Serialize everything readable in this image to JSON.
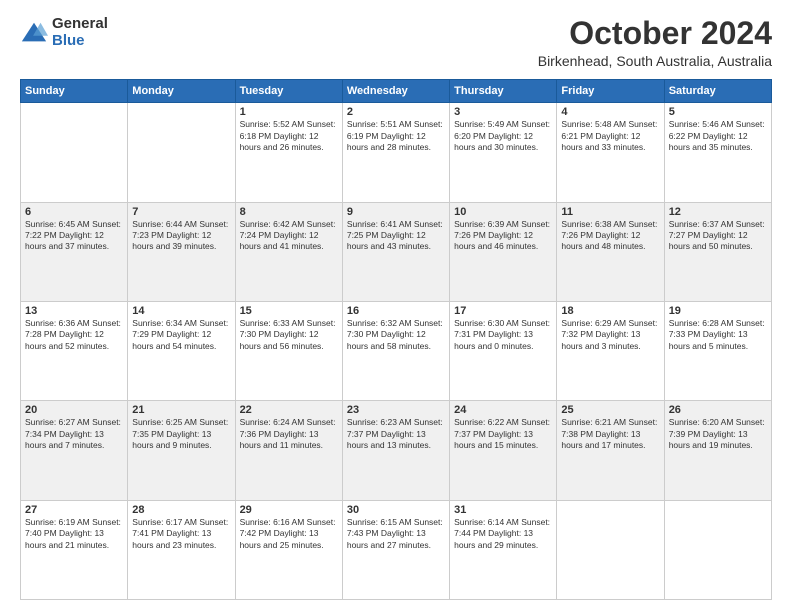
{
  "logo": {
    "general": "General",
    "blue": "Blue"
  },
  "title": "October 2024",
  "subtitle": "Birkenhead, South Australia, Australia",
  "days_of_week": [
    "Sunday",
    "Monday",
    "Tuesday",
    "Wednesday",
    "Thursday",
    "Friday",
    "Saturday"
  ],
  "weeks": [
    [
      {
        "day": "",
        "info": ""
      },
      {
        "day": "",
        "info": ""
      },
      {
        "day": "1",
        "info": "Sunrise: 5:52 AM\nSunset: 6:18 PM\nDaylight: 12 hours\nand 26 minutes."
      },
      {
        "day": "2",
        "info": "Sunrise: 5:51 AM\nSunset: 6:19 PM\nDaylight: 12 hours\nand 28 minutes."
      },
      {
        "day": "3",
        "info": "Sunrise: 5:49 AM\nSunset: 6:20 PM\nDaylight: 12 hours\nand 30 minutes."
      },
      {
        "day": "4",
        "info": "Sunrise: 5:48 AM\nSunset: 6:21 PM\nDaylight: 12 hours\nand 33 minutes."
      },
      {
        "day": "5",
        "info": "Sunrise: 5:46 AM\nSunset: 6:22 PM\nDaylight: 12 hours\nand 35 minutes."
      }
    ],
    [
      {
        "day": "6",
        "info": "Sunrise: 6:45 AM\nSunset: 7:22 PM\nDaylight: 12 hours\nand 37 minutes."
      },
      {
        "day": "7",
        "info": "Sunrise: 6:44 AM\nSunset: 7:23 PM\nDaylight: 12 hours\nand 39 minutes."
      },
      {
        "day": "8",
        "info": "Sunrise: 6:42 AM\nSunset: 7:24 PM\nDaylight: 12 hours\nand 41 minutes."
      },
      {
        "day": "9",
        "info": "Sunrise: 6:41 AM\nSunset: 7:25 PM\nDaylight: 12 hours\nand 43 minutes."
      },
      {
        "day": "10",
        "info": "Sunrise: 6:39 AM\nSunset: 7:26 PM\nDaylight: 12 hours\nand 46 minutes."
      },
      {
        "day": "11",
        "info": "Sunrise: 6:38 AM\nSunset: 7:26 PM\nDaylight: 12 hours\nand 48 minutes."
      },
      {
        "day": "12",
        "info": "Sunrise: 6:37 AM\nSunset: 7:27 PM\nDaylight: 12 hours\nand 50 minutes."
      }
    ],
    [
      {
        "day": "13",
        "info": "Sunrise: 6:36 AM\nSunset: 7:28 PM\nDaylight: 12 hours\nand 52 minutes."
      },
      {
        "day": "14",
        "info": "Sunrise: 6:34 AM\nSunset: 7:29 PM\nDaylight: 12 hours\nand 54 minutes."
      },
      {
        "day": "15",
        "info": "Sunrise: 6:33 AM\nSunset: 7:30 PM\nDaylight: 12 hours\nand 56 minutes."
      },
      {
        "day": "16",
        "info": "Sunrise: 6:32 AM\nSunset: 7:30 PM\nDaylight: 12 hours\nand 58 minutes."
      },
      {
        "day": "17",
        "info": "Sunrise: 6:30 AM\nSunset: 7:31 PM\nDaylight: 13 hours\nand 0 minutes."
      },
      {
        "day": "18",
        "info": "Sunrise: 6:29 AM\nSunset: 7:32 PM\nDaylight: 13 hours\nand 3 minutes."
      },
      {
        "day": "19",
        "info": "Sunrise: 6:28 AM\nSunset: 7:33 PM\nDaylight: 13 hours\nand 5 minutes."
      }
    ],
    [
      {
        "day": "20",
        "info": "Sunrise: 6:27 AM\nSunset: 7:34 PM\nDaylight: 13 hours\nand 7 minutes."
      },
      {
        "day": "21",
        "info": "Sunrise: 6:25 AM\nSunset: 7:35 PM\nDaylight: 13 hours\nand 9 minutes."
      },
      {
        "day": "22",
        "info": "Sunrise: 6:24 AM\nSunset: 7:36 PM\nDaylight: 13 hours\nand 11 minutes."
      },
      {
        "day": "23",
        "info": "Sunrise: 6:23 AM\nSunset: 7:37 PM\nDaylight: 13 hours\nand 13 minutes."
      },
      {
        "day": "24",
        "info": "Sunrise: 6:22 AM\nSunset: 7:37 PM\nDaylight: 13 hours\nand 15 minutes."
      },
      {
        "day": "25",
        "info": "Sunrise: 6:21 AM\nSunset: 7:38 PM\nDaylight: 13 hours\nand 17 minutes."
      },
      {
        "day": "26",
        "info": "Sunrise: 6:20 AM\nSunset: 7:39 PM\nDaylight: 13 hours\nand 19 minutes."
      }
    ],
    [
      {
        "day": "27",
        "info": "Sunrise: 6:19 AM\nSunset: 7:40 PM\nDaylight: 13 hours\nand 21 minutes."
      },
      {
        "day": "28",
        "info": "Sunrise: 6:17 AM\nSunset: 7:41 PM\nDaylight: 13 hours\nand 23 minutes."
      },
      {
        "day": "29",
        "info": "Sunrise: 6:16 AM\nSunset: 7:42 PM\nDaylight: 13 hours\nand 25 minutes."
      },
      {
        "day": "30",
        "info": "Sunrise: 6:15 AM\nSunset: 7:43 PM\nDaylight: 13 hours\nand 27 minutes."
      },
      {
        "day": "31",
        "info": "Sunrise: 6:14 AM\nSunset: 7:44 PM\nDaylight: 13 hours\nand 29 minutes."
      },
      {
        "day": "",
        "info": ""
      },
      {
        "day": "",
        "info": ""
      }
    ]
  ]
}
